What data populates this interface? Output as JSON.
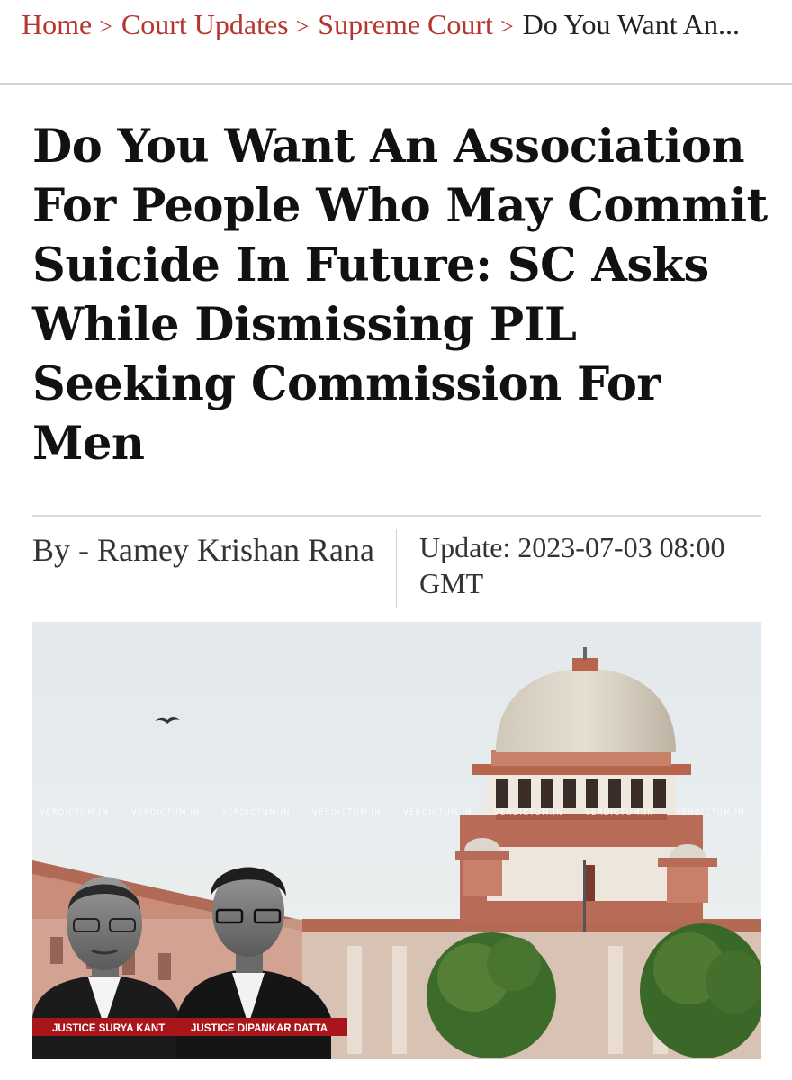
{
  "breadcrumb": {
    "home": "Home",
    "court_updates": "Court Updates",
    "supreme_court": "Supreme Court",
    "current": "Do You Want An...",
    "separator": ">"
  },
  "article": {
    "title": "Do You Want An Association For People Who May Commit Suicide In Future: SC Asks While Dismissing PIL Seeking Commission For Men",
    "author": "By - Ramey Krishan Rana",
    "updated": "Update: 2023-07-03 08:00 GMT"
  },
  "image": {
    "watermark": "VERDICTUM.IN",
    "caption_left": "JUSTICE SURYA KANT",
    "caption_right": "JUSTICE DIPANKAR DATTA"
  },
  "colors": {
    "link": "#b5362f",
    "caption_bg": "#a8161b"
  }
}
